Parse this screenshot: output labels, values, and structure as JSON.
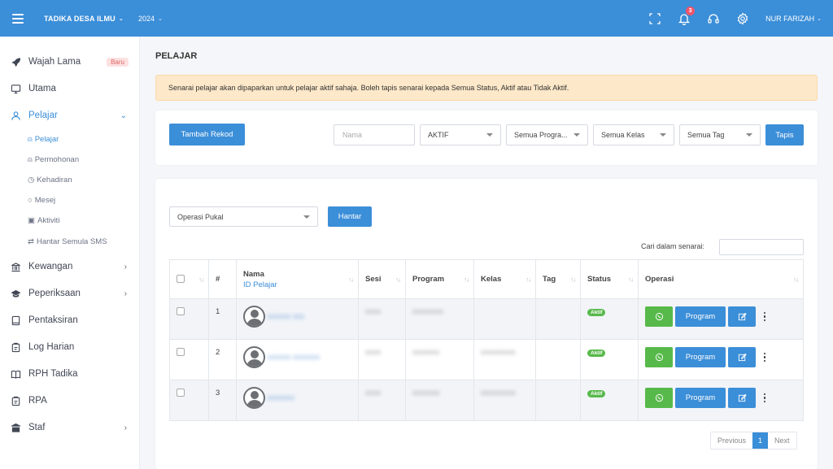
{
  "topbar": {
    "brand": "TADIKA DESA ILMU",
    "year": "2024",
    "notification_count": "3",
    "user": "NUR FARIZAH"
  },
  "sidebar": {
    "items": [
      {
        "label": "Wajah Lama",
        "icon": "rocket-icon",
        "badge": "Baru"
      },
      {
        "label": "Utama",
        "icon": "monitor-icon"
      },
      {
        "label": "Pelajar",
        "icon": "user-icon",
        "expanded": true
      },
      {
        "label": "Kewangan",
        "icon": "bank-icon"
      },
      {
        "label": "Peperiksaan",
        "icon": "graduation-cap-icon"
      },
      {
        "label": "Pentaksiran",
        "icon": "tablet-icon"
      },
      {
        "label": "Log Harian",
        "icon": "clipboard-icon"
      },
      {
        "label": "RPH Tadika",
        "icon": "book-icon"
      },
      {
        "label": "RPA",
        "icon": "clipboard-icon"
      },
      {
        "label": "Staf",
        "icon": "school-icon"
      }
    ],
    "sub_items": [
      {
        "label": "Pelajar",
        "icon": "user-icon",
        "active": true
      },
      {
        "label": "Permohonan",
        "icon": "user-plus-icon"
      },
      {
        "label": "Kehadiran",
        "icon": "clock-icon"
      },
      {
        "label": "Mesej",
        "icon": "chat-icon"
      },
      {
        "label": "Aktiviti",
        "icon": "image-icon"
      },
      {
        "label": "Hantar Semula SMS",
        "icon": "repeat-icon"
      }
    ]
  },
  "page": {
    "title": "PELAJAR",
    "alert": "Senarai pelajar akan dipaparkan untuk pelajar aktif sahaja. Boleh tapis senarai kepada Semua Status, Aktif atau Tidak Aktif."
  },
  "filters": {
    "add_button": "Tambah Rekod",
    "name_placeholder": "Nama",
    "status": "AKTIF",
    "program": "Semua Progra...",
    "kelas": "Semua Kelas",
    "tag": "Semua Tag",
    "filter_button": "Tapis"
  },
  "bulk": {
    "operation": "Operasi Pukal",
    "submit": "Hantar",
    "search_label": "Cari dalam senarai:"
  },
  "table": {
    "headers": {
      "num": "#",
      "name": "Nama",
      "id": "ID Pelajar",
      "sesi": "Sesi",
      "program": "Program",
      "kelas": "Kelas",
      "tag": "Tag",
      "status": "Status",
      "operasi": "Operasi"
    },
    "rows": [
      {
        "num": "1",
        "name": "xxxxxx xxx",
        "sesi": "xxxx",
        "program": "xxxxxxxx",
        "kelas": "",
        "status": "Aktif",
        "program_button": "Program"
      },
      {
        "num": "2",
        "name": "xxxxxx xxxxxxx",
        "sesi": "xxxx",
        "program": "xxxxxxx",
        "kelas": "xxxxxxxxx",
        "status": "Aktif",
        "program_button": "Program"
      },
      {
        "num": "3",
        "name": "xxxxxxx",
        "sesi": "xxxx",
        "program": "xxxxxxx",
        "kelas": "xxxxxxxxx",
        "status": "Aktif",
        "program_button": "Program"
      }
    ]
  },
  "pagination": {
    "previous": "Previous",
    "current": "1",
    "next": "Next"
  },
  "colors": {
    "primary": "#3b8ed8",
    "success": "#58b94b",
    "alert_bg": "#fde8c9",
    "badge_red": "#f1556c"
  }
}
